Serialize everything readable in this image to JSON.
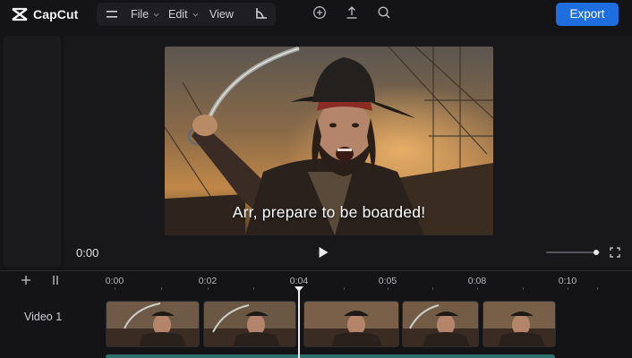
{
  "app": {
    "name": "CapCut"
  },
  "menu": {
    "items": [
      {
        "label": "File",
        "has_chevron": true
      },
      {
        "label": "Edit",
        "has_chevron": true
      },
      {
        "label": "View",
        "has_chevron": false
      }
    ]
  },
  "toolbar": {
    "icons": [
      "add-circle-icon",
      "upload-icon",
      "search-icon"
    ],
    "export_label": "Export",
    "accent_color": "#1f6ee0"
  },
  "player": {
    "caption": "Arr, prepare to be boarded!",
    "current_time": "0:00",
    "volume_level": 0.93
  },
  "timeline": {
    "ruler_labels": [
      "0:00",
      "0:02",
      "0:04",
      "0:05",
      "0:08",
      "0:10"
    ],
    "playhead_time": "0:04",
    "tracks": [
      {
        "label": "Video 1",
        "clip_count": 5
      }
    ],
    "audio_color": "#2f6f6a"
  }
}
